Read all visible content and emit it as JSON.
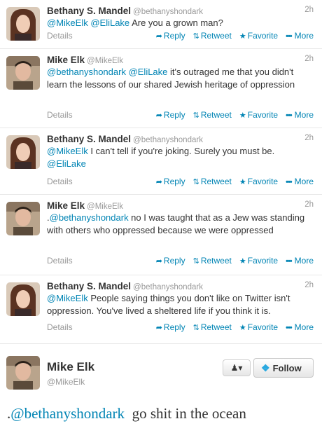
{
  "actions": {
    "reply": "Reply",
    "retweet": "Retweet",
    "favorite": "Favorite",
    "more": "More",
    "details": "Details"
  },
  "icons": {
    "reply": "reply-arrow-icon",
    "retweet": "retweet-icon",
    "favorite": "star-icon",
    "more": "more-dots-icon"
  },
  "colors": {
    "link": "#0084b4",
    "muted": "#999999",
    "text": "#333333"
  },
  "tweets": [
    {
      "name": "Bethany S. Mandel",
      "handle": "@bethanyshondark",
      "time": "2h",
      "segments": [
        {
          "text": "@MikeElk",
          "mention": true
        },
        {
          "text": " ",
          "mention": false
        },
        {
          "text": "@EliLake",
          "mention": true
        },
        {
          "text": " Are you a grown man?",
          "mention": false
        }
      ]
    },
    {
      "name": "Mike Elk",
      "handle": "@MikeElk",
      "time": "2h",
      "segments": [
        {
          "text": "@bethanyshondark",
          "mention": true
        },
        {
          "text": " ",
          "mention": false
        },
        {
          "text": "@EliLake",
          "mention": true
        },
        {
          "text": " it's outraged me that you didn't learn the lessons of our shared Jewish heritage of oppression",
          "mention": false
        }
      ]
    },
    {
      "name": "Bethany S. Mandel",
      "handle": "@bethanyshondark",
      "time": "2h",
      "segments": [
        {
          "text": "@MikeElk",
          "mention": true
        },
        {
          "text": " I can't tell if you're joking. Surely you must be. ",
          "mention": false
        },
        {
          "text": "@EliLake",
          "mention": true
        }
      ]
    },
    {
      "name": "Mike Elk",
      "handle": "@MikeElk",
      "time": "2h",
      "segments": [
        {
          "text": ".",
          "mention": false
        },
        {
          "text": "@bethanyshondark",
          "mention": true
        },
        {
          "text": " no I was taught that as a Jew was standing with others who oppressed because we were oppressed",
          "mention": false
        }
      ]
    },
    {
      "name": "Bethany S. Mandel",
      "handle": "@bethanyshondark",
      "time": "2h",
      "segments": [
        {
          "text": "@MikeElk",
          "mention": true
        },
        {
          "text": " People saying things you don't like on Twitter isn't oppression. You've lived a sheltered life if you think it is.",
          "mention": false
        }
      ]
    }
  ],
  "profile": {
    "name": "Mike Elk",
    "handle": "@MikeElk",
    "follow_label": "Follow",
    "user_menu_icon": "user-dropdown-icon"
  },
  "main_tweet": {
    "prefix": ".",
    "mention": "@bethanyshondark",
    "text": "  go shit in the ocean"
  }
}
